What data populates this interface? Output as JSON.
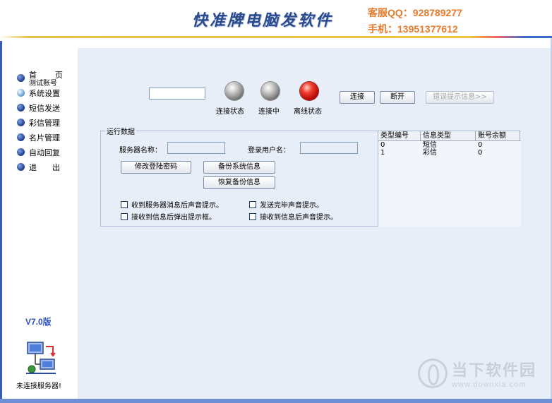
{
  "header": {
    "logo_text": "快准牌电脑发软件",
    "contact_qq": "客服QQ：928789277",
    "contact_phone": "手机：13951377612"
  },
  "sidebar": {
    "home_label": "首页",
    "test_account_label": "测试账号",
    "items": [
      {
        "label": "系统设置",
        "active": true
      },
      {
        "label": "短信发送"
      },
      {
        "label": "彩信管理"
      },
      {
        "label": "名片管理"
      },
      {
        "label": "自动回复"
      },
      {
        "label": "退出"
      }
    ],
    "version": "V7.0版",
    "server_status": "未连接服务器!"
  },
  "status": {
    "lights": [
      {
        "label": "连接状态",
        "color": "gray"
      },
      {
        "label": "连接中",
        "color": "gray"
      },
      {
        "label": "离线状态",
        "color": "red"
      }
    ],
    "connect_button": "连接",
    "disconnect_button": "断开",
    "error_button": "错误提示信息>>"
  },
  "run_data": {
    "title": "运行数据",
    "server_name_label": "服务器名称：",
    "server_name_value": "",
    "login_user_label": "登录用户名：",
    "login_user_value": "",
    "change_password_button": "修改登陆密码",
    "backup_button": "备份系统信息",
    "restore_button": "恢复备份信息",
    "checkboxes": [
      {
        "label": "收到服务器消息后声音提示。",
        "checked": false
      },
      {
        "label": "发送完毕声音提示。",
        "checked": false
      },
      {
        "label": "接收到信息后弹出提示框。",
        "checked": false
      },
      {
        "label": "接收到信息后声音提示。",
        "checked": false
      }
    ]
  },
  "account_table": {
    "columns": [
      "类型编号",
      "信息类型",
      "账号余额"
    ],
    "rows": [
      [
        "0",
        "短信",
        "0"
      ],
      [
        "1",
        "彩信",
        "0"
      ]
    ]
  },
  "watermark": {
    "title": "当下软件园",
    "url": "www.downxia.com"
  },
  "colors": {
    "accent_blue": "#2a4fc0",
    "contact_orange": "#e8792a",
    "panel_bg": "#e8eef8"
  }
}
